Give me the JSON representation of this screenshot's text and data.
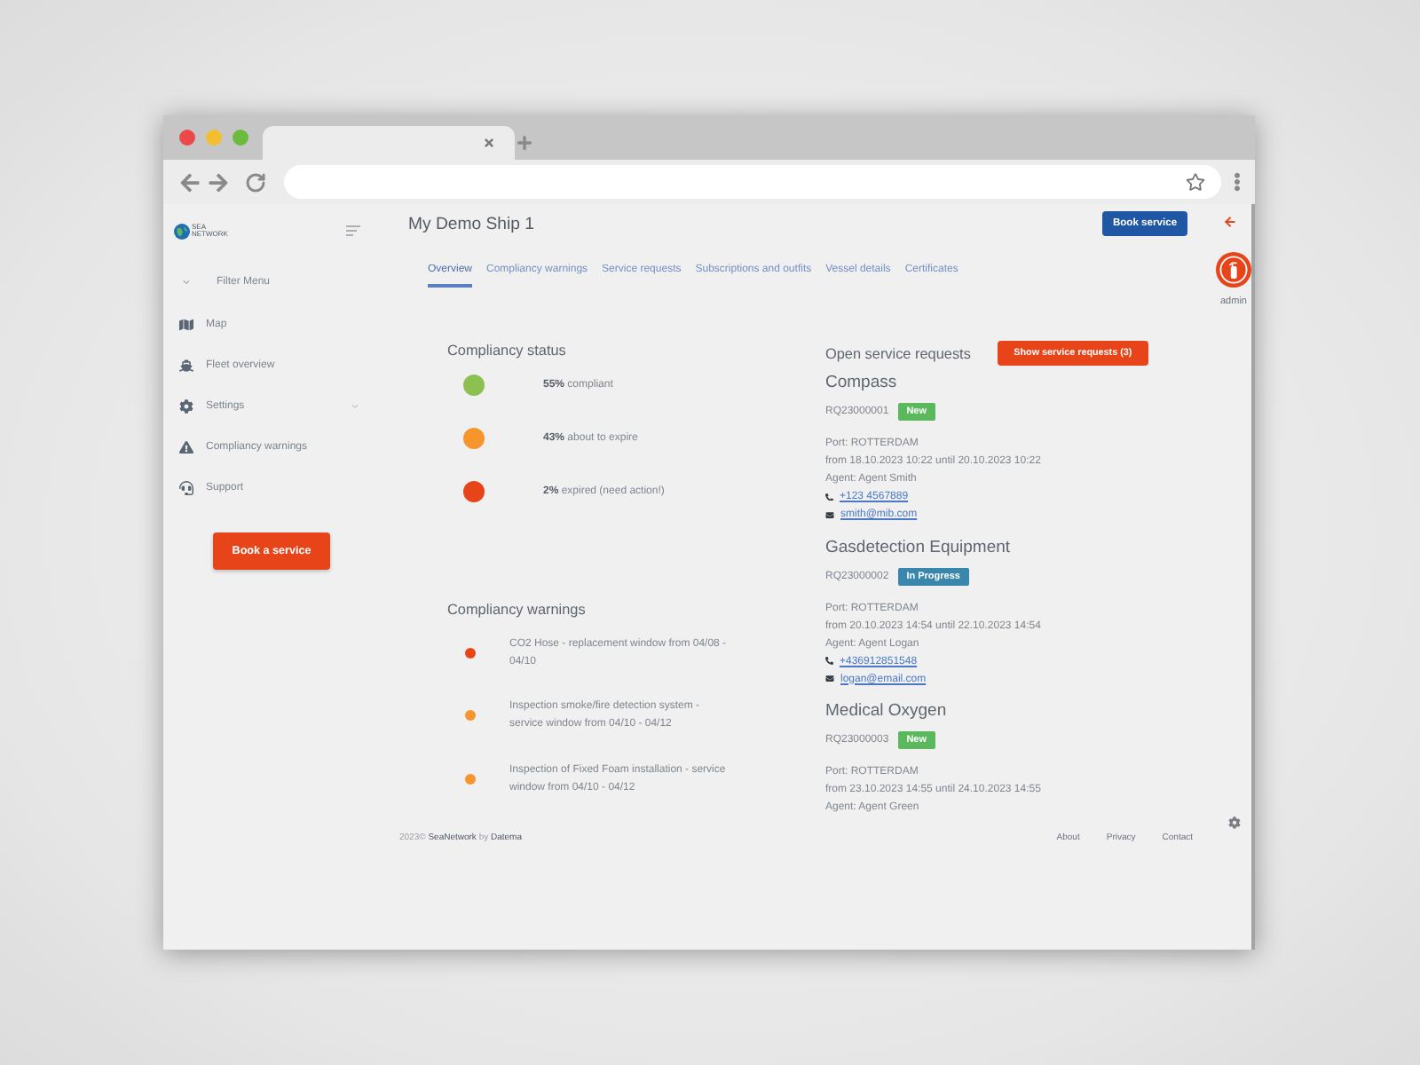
{
  "sidebar": {
    "logo_text": "SEA NETWORK",
    "filter_menu": "Filter Menu",
    "items": [
      {
        "label": "Map",
        "kind": "link"
      },
      {
        "label": "Fleet overview",
        "kind": "link"
      },
      {
        "label": "Settings",
        "kind": "group"
      },
      {
        "label": "Compliancy warnings",
        "kind": "link"
      },
      {
        "label": "Support",
        "kind": "link"
      }
    ],
    "book_button": "Book a service"
  },
  "header": {
    "title": "My Demo Ship 1",
    "book_button": "Book service",
    "tabs": [
      {
        "label": "Overview",
        "selected": true
      },
      {
        "label": "Compliancy warnings",
        "selected": false
      },
      {
        "label": "Service requests",
        "selected": false
      },
      {
        "label": "Subscriptions and outfits",
        "selected": false
      },
      {
        "label": "Vessel details",
        "selected": false
      },
      {
        "label": "Certificates",
        "selected": false
      }
    ]
  },
  "user": {
    "name": "admin"
  },
  "compliancy_status": {
    "title": "Compliancy status",
    "items": [
      {
        "text": "**55%** compliant",
        "color": "#8cc152"
      },
      {
        "text": "**43%** about to expire",
        "color": "#f7952d"
      },
      {
        "text": "**2%** expired (need action!)",
        "color": "#e8441a"
      }
    ]
  },
  "compliancy_warnings": {
    "title": "Compliancy warnings",
    "items": [
      {
        "text": "CO2 Hose - replacement window from 04/08 - 04/10",
        "color": "#e8441a"
      },
      {
        "text": "Inspection smoke/fire detection system - service window from 04/10 - 04/12",
        "color": "#f7952d"
      },
      {
        "text": "Inspection of Fixed Foam installation - service window from 04/10 - 04/12",
        "color": "#f7952d"
      }
    ]
  },
  "service_requests": {
    "title": "Open service requests",
    "button": "Show service requests (3)",
    "items": [
      {
        "name": "Compass",
        "id": "RQ23000001",
        "badge": {
          "label": "New",
          "color": "#5cb85c"
        },
        "port": "Port: ROTTERDAM",
        "period": "from 18.10.2023 10:22 until 20.10.2023 10:22",
        "agent": "Agent: Agent Smith",
        "phone": "+123 4567889",
        "email": "smith@mib.com"
      },
      {
        "name": "Gasdetection Equipment",
        "id": "RQ23000002",
        "badge": {
          "label": "In Progress",
          "color": "#3a87ad"
        },
        "port": "Port: ROTTERDAM",
        "period": "from 20.10.2023 14:54 until 22.10.2023 14:54",
        "agent": "Agent: Agent Logan",
        "phone": "+436912851548",
        "email": "logan@email.com"
      },
      {
        "name": "Medical Oxygen",
        "id": "RQ23000003",
        "badge": {
          "label": "New",
          "color": "#5cb85c"
        },
        "port": "Port: ROTTERDAM",
        "period": "from 23.10.2023 14:55 until 24.10.2023 14:55",
        "agent": "Agent: Agent Green"
      }
    ]
  },
  "footer": {
    "year": "2023©",
    "brand": "SeaNetwork",
    "by": "by",
    "company": "Datema",
    "links": [
      "About",
      "Privacy",
      "Contact"
    ]
  }
}
